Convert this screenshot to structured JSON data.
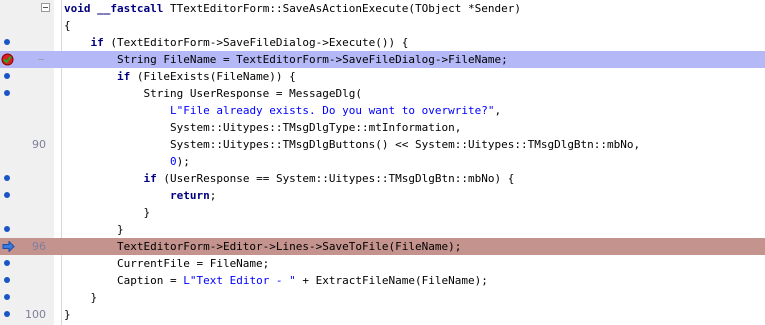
{
  "gutter": {
    "line_numbers": [
      "90",
      "96",
      "100"
    ],
    "markers": [
      "blue-dot",
      "breakpoint-check",
      "blue-dot",
      "execution-arrow"
    ]
  },
  "code": {
    "l1": {
      "a": "void ",
      "b": "__fastcall",
      "c": " TTextEditorForm::SaveAsActionExecute(TObject *Sender)"
    },
    "l2": "{",
    "l3": {
      "a": "    ",
      "b": "if",
      "c": " (TextEditorForm->SaveFileDialog->Execute()) {"
    },
    "l4": "        String FileName = TextEditorForm->SaveFileDialog->FileName;",
    "l5": {
      "a": "        ",
      "b": "if",
      "c": " (FileExists(FileName)) {"
    },
    "l6": "            String UserResponse = MessageDlg(",
    "l7": {
      "a": "                ",
      "b": "L\"File already exists. Do you want to overwrite?\"",
      "c": ","
    },
    "l8": "                System::Uitypes::TMsgDlgType::mtInformation,",
    "l9": "                System::Uitypes::TMsgDlgButtons() << System::Uitypes::TMsgDlgBtn::mbNo,",
    "l10": {
      "a": "                ",
      "b": "0",
      "c": ");"
    },
    "l11": {
      "a": "            ",
      "b": "if",
      "c": " (UserResponse == System::Uitypes::TMsgDlgBtn::mbNo) {"
    },
    "l12": {
      "a": "                ",
      "b": "return",
      "c": ";"
    },
    "l13": "            }",
    "l14": "        }",
    "l15": "        TextEditorForm->Editor->Lines->SaveToFile(FileName);",
    "l16": "        CurrentFile = FileName;",
    "l17": {
      "a": "        Caption = ",
      "b": "L\"Text Editor - \"",
      "c": " + ExtractFileName(FileName);"
    },
    "l18": "    }",
    "l19": "}"
  },
  "colors": {
    "highlight_blue": "#b4b8f6",
    "highlight_red": "#c4938e",
    "keyword": "#000080",
    "string": "#0000ff"
  }
}
